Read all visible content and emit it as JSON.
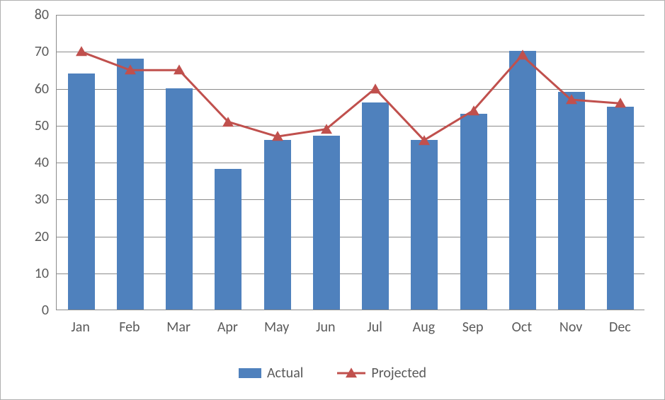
{
  "chart_data": {
    "type": "bar",
    "categories": [
      "Jan",
      "Feb",
      "Mar",
      "Apr",
      "May",
      "Jun",
      "Jul",
      "Aug",
      "Sep",
      "Oct",
      "Nov",
      "Dec"
    ],
    "series": [
      {
        "name": "Actual",
        "values": [
          64,
          68,
          60,
          38,
          46,
          47,
          56,
          46,
          53,
          70,
          59,
          55
        ],
        "kind": "bar",
        "color": "#4f81bd"
      },
      {
        "name": "Projected",
        "values": [
          70,
          65,
          65,
          51,
          47,
          49,
          60,
          46,
          54,
          69,
          57,
          56
        ],
        "kind": "line",
        "color": "#c0504d",
        "marker": "triangle"
      }
    ],
    "ylim": [
      0,
      80
    ],
    "yticks": [
      0,
      10,
      20,
      30,
      40,
      50,
      60,
      70,
      80
    ],
    "title": "",
    "xlabel": "",
    "ylabel": "",
    "legend_position": "bottom",
    "grid": true
  },
  "legend": {
    "actual_label": "Actual",
    "projected_label": "Projected"
  }
}
